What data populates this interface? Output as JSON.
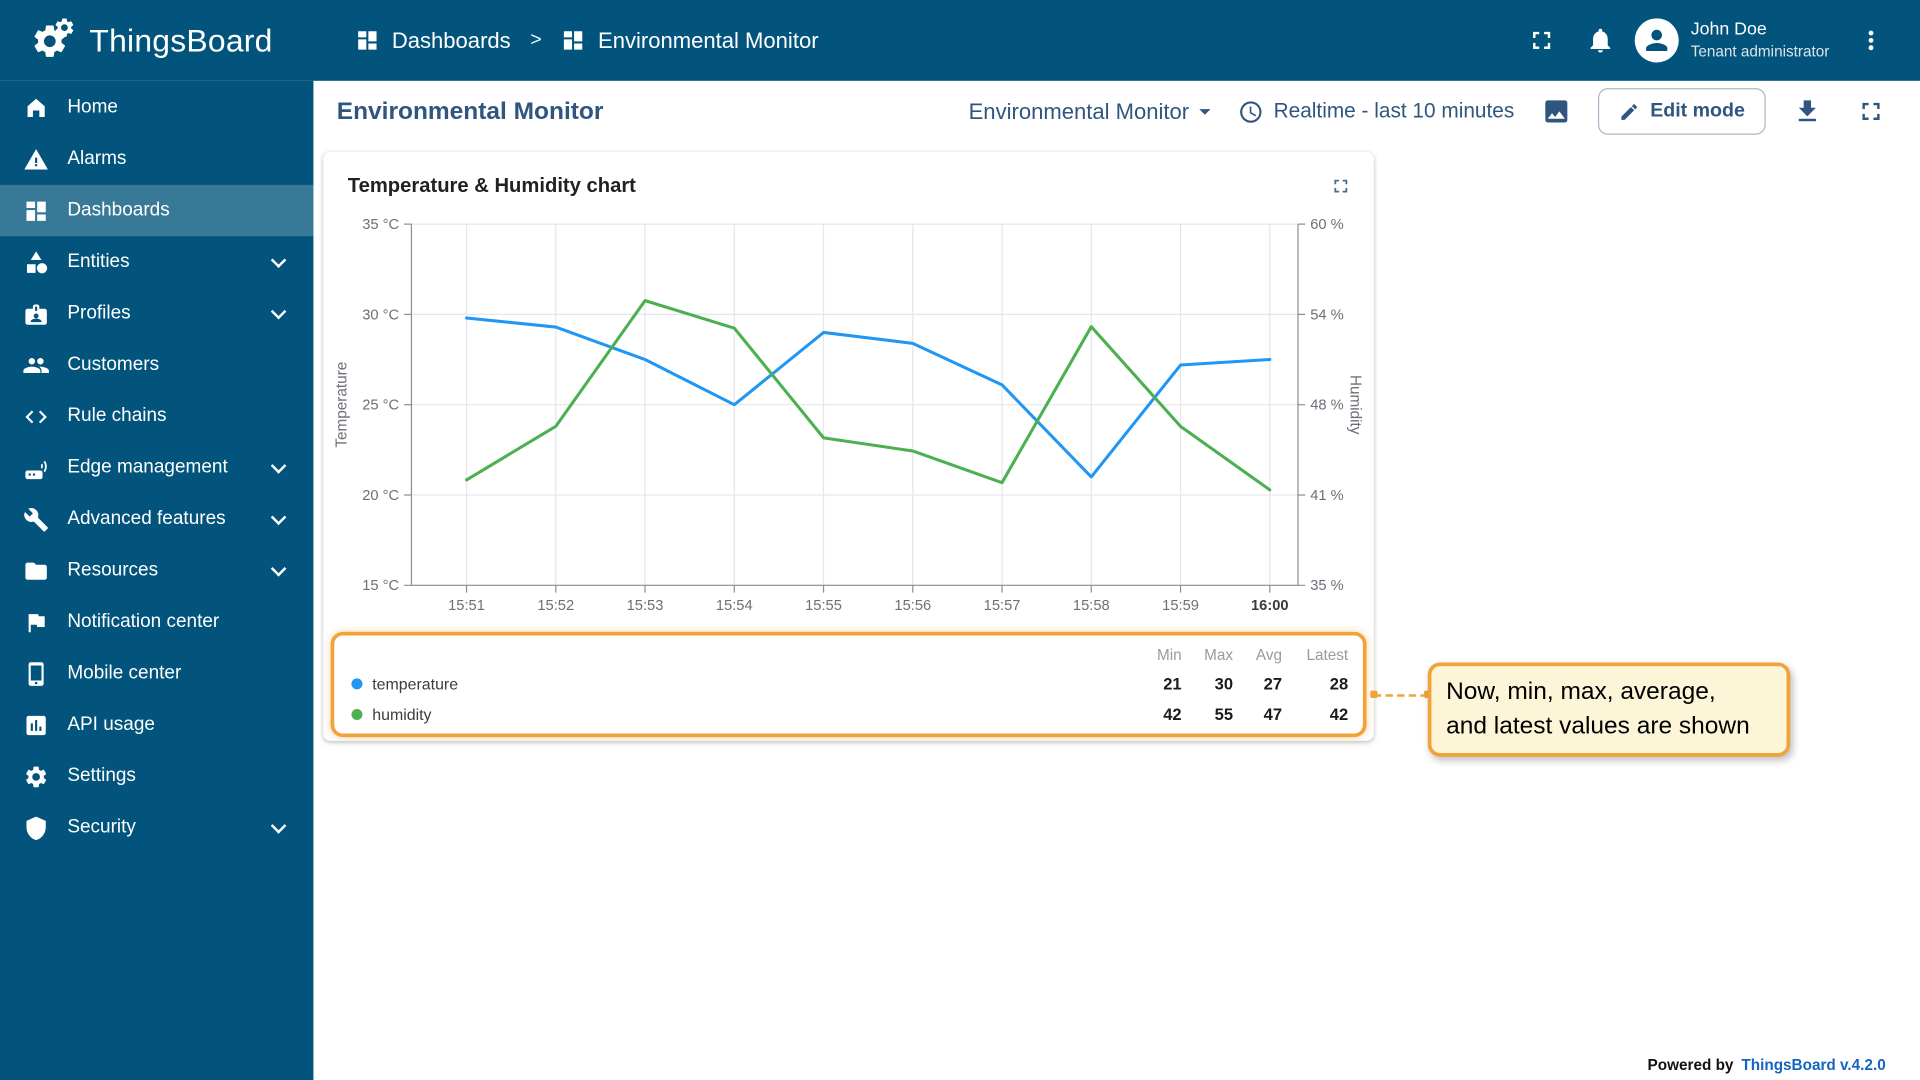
{
  "colors": {
    "primary": "#02547C",
    "toolbar_text": "#305680",
    "temperature_series": "#2196F3",
    "humidity_series": "#4CAF50",
    "annotation_orange": "#F1A33B"
  },
  "app": {
    "name": "ThingsBoard"
  },
  "topbar": {
    "breadcrumb_separator": ">",
    "breadcrumb": [
      {
        "label": "Dashboards",
        "icon": "dashboards"
      },
      {
        "label": "Environmental Monitor",
        "icon": "dashboards"
      }
    ],
    "user": {
      "name": "John Doe",
      "role": "Tenant administrator"
    },
    "icons": [
      "fullscreen-icon",
      "notifications-bell-icon",
      "avatar-person-icon",
      "more-vert-icon"
    ]
  },
  "sidebar": {
    "items": [
      {
        "label": "Home",
        "icon": "home"
      },
      {
        "label": "Alarms",
        "icon": "alarm"
      },
      {
        "label": "Dashboards",
        "icon": "dashboards",
        "active": true
      },
      {
        "label": "Entities",
        "icon": "entities",
        "expandable": true
      },
      {
        "label": "Profiles",
        "icon": "profiles",
        "expandable": true
      },
      {
        "label": "Customers",
        "icon": "customers"
      },
      {
        "label": "Rule chains",
        "icon": "rule-chains"
      },
      {
        "label": "Edge management",
        "icon": "edge",
        "expandable": true
      },
      {
        "label": "Advanced features",
        "icon": "advanced",
        "expandable": true
      },
      {
        "label": "Resources",
        "icon": "resources",
        "expandable": true
      },
      {
        "label": "Notification center",
        "icon": "notification"
      },
      {
        "label": "Mobile center",
        "icon": "mobile"
      },
      {
        "label": "API usage",
        "icon": "api"
      },
      {
        "label": "Settings",
        "icon": "settings"
      },
      {
        "label": "Security",
        "icon": "security",
        "expandable": true
      }
    ]
  },
  "toolbar": {
    "title": "Environmental Monitor",
    "dashboard_selector": "Environmental Monitor",
    "timewindow": "Realtime - last 10 minutes",
    "edit_button": "Edit mode"
  },
  "widget": {
    "title": "Temperature & Humidity chart",
    "legend": {
      "columns": [
        "Min",
        "Max",
        "Avg",
        "Latest"
      ],
      "rows": [
        {
          "name": "temperature",
          "color": "#2196F3",
          "min": "21",
          "max": "30",
          "avg": "27",
          "latest": "28"
        },
        {
          "name": "humidity",
          "color": "#4CAF50",
          "min": "42",
          "max": "55",
          "avg": "47",
          "latest": "42"
        }
      ]
    }
  },
  "annotation": {
    "lines": [
      "Now, min, max, average,",
      "and latest values are shown"
    ]
  },
  "footer": {
    "powered_by": "Powered by",
    "version": "ThingsBoard v.4.2.0"
  },
  "chart_data": {
    "type": "line",
    "x": [
      "15:51",
      "15:52",
      "15:53",
      "15:54",
      "15:55",
      "15:56",
      "15:57",
      "15:58",
      "15:59",
      "16:00"
    ],
    "series": [
      {
        "name": "temperature",
        "axis": "left",
        "color": "#2196F3",
        "values": [
          29.8,
          29.3,
          27.5,
          25,
          29,
          28.4,
          26.1,
          21,
          27.2,
          27.5
        ]
      },
      {
        "name": "humidity",
        "axis": "right",
        "color": "#4CAF50",
        "values": [
          42.3,
          46,
          54.7,
          52.8,
          45.2,
          44.3,
          42.1,
          52.9,
          46,
          41.6
        ]
      }
    ],
    "left_axis": {
      "label": "Temperature",
      "min": 15,
      "max": 35,
      "ticks": [
        "35 °C",
        "30 °C",
        "25 °C",
        "20 °C",
        "15 °C"
      ]
    },
    "right_axis": {
      "label": "Humidity",
      "min": 35,
      "max": 60,
      "ticks": [
        "60 %",
        "54 %",
        "48 %",
        "41 %",
        "35 %"
      ]
    },
    "grid": true,
    "legend_position": "bottom"
  }
}
